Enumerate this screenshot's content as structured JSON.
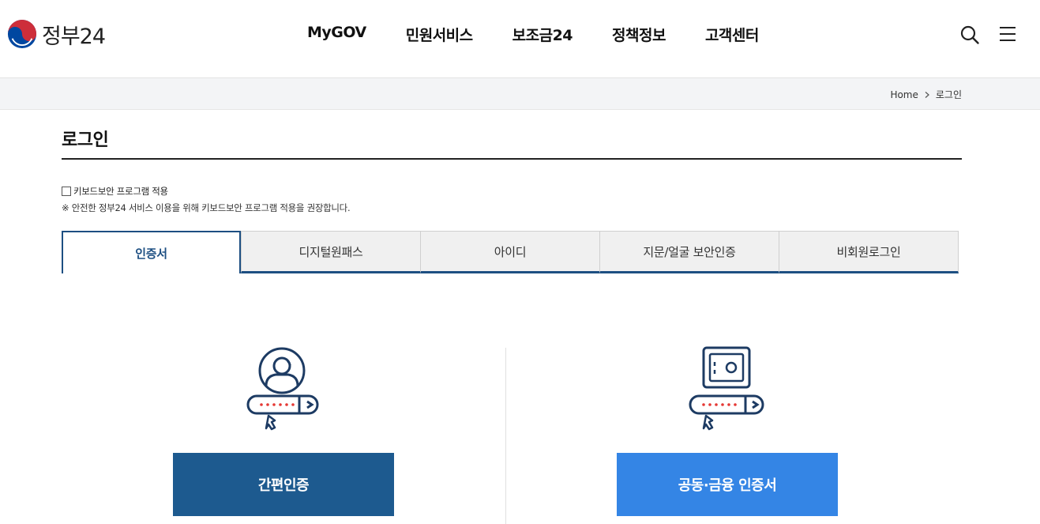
{
  "header": {
    "logo_text": "정부24",
    "nav": [
      "MyGOV",
      "민원서비스",
      "보조금24",
      "정책정보",
      "고객센터"
    ],
    "icons": [
      "search-icon",
      "hamburger-menu-icon"
    ]
  },
  "breadcrumb": {
    "home": "Home",
    "current": "로그인"
  },
  "page": {
    "title": "로그인",
    "keyboard_label": "키보드보안 프로그램 적용",
    "keyboard_note": "※ 안전한 정부24 서비스 이용을 위해 키보드보안 프로그램 적용을 권장합니다."
  },
  "tabs": [
    {
      "label": "인증서",
      "active": true
    },
    {
      "label": "디지털원패스",
      "active": false
    },
    {
      "label": "아이디",
      "active": false
    },
    {
      "label": "지문/얼굴 보안인증",
      "active": false
    },
    {
      "label": "비회원로그인",
      "active": false
    }
  ],
  "methods": {
    "simple_label": "간편인증",
    "joint_label": "공동·금융 인증서",
    "simple_icon": "user-password-icon",
    "joint_icon": "safe-password-icon"
  },
  "colors": {
    "navy": "#1d4f82",
    "simple_button": "#1d5a8f",
    "joint_button": "#3485e5",
    "logo_red": "#cd2e3a",
    "logo_blue": "#0047a0"
  }
}
